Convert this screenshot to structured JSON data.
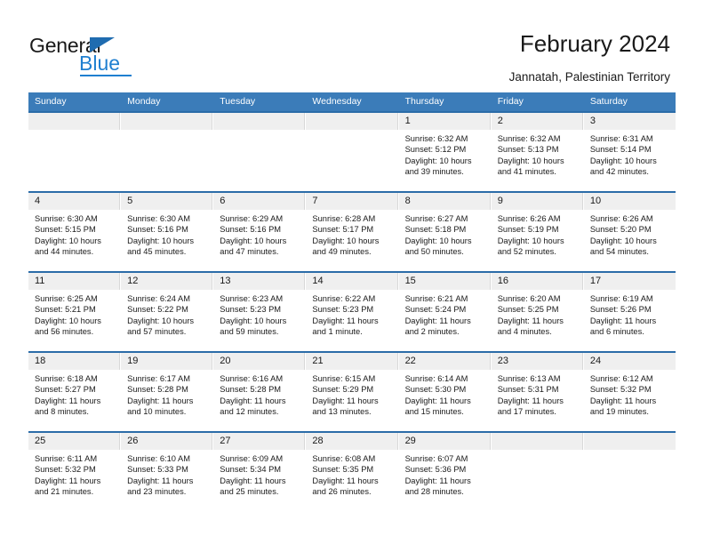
{
  "brand": {
    "name_part1": "General",
    "name_part2": "Blue",
    "triangle_icon": "triangle-icon",
    "colors": {
      "dark": "#1a1a1a",
      "blue": "#1f7fd0",
      "header_blue": "#3b7cb9",
      "separator_blue": "#2b6ca8",
      "daynum_band": "#efefef"
    }
  },
  "header": {
    "title": "February 2024",
    "subtitle": "Jannatah, Palestinian Territory"
  },
  "calendar": {
    "weekdays": [
      "Sunday",
      "Monday",
      "Tuesday",
      "Wednesday",
      "Thursday",
      "Friday",
      "Saturday"
    ],
    "weeks": [
      [
        {
          "day": "",
          "sunrise": "",
          "sunset": "",
          "daylight1": "",
          "daylight2": ""
        },
        {
          "day": "",
          "sunrise": "",
          "sunset": "",
          "daylight1": "",
          "daylight2": ""
        },
        {
          "day": "",
          "sunrise": "",
          "sunset": "",
          "daylight1": "",
          "daylight2": ""
        },
        {
          "day": "",
          "sunrise": "",
          "sunset": "",
          "daylight1": "",
          "daylight2": ""
        },
        {
          "day": "1",
          "sunrise": "Sunrise: 6:32 AM",
          "sunset": "Sunset: 5:12 PM",
          "daylight1": "Daylight: 10 hours",
          "daylight2": "and 39 minutes."
        },
        {
          "day": "2",
          "sunrise": "Sunrise: 6:32 AM",
          "sunset": "Sunset: 5:13 PM",
          "daylight1": "Daylight: 10 hours",
          "daylight2": "and 41 minutes."
        },
        {
          "day": "3",
          "sunrise": "Sunrise: 6:31 AM",
          "sunset": "Sunset: 5:14 PM",
          "daylight1": "Daylight: 10 hours",
          "daylight2": "and 42 minutes."
        }
      ],
      [
        {
          "day": "4",
          "sunrise": "Sunrise: 6:30 AM",
          "sunset": "Sunset: 5:15 PM",
          "daylight1": "Daylight: 10 hours",
          "daylight2": "and 44 minutes."
        },
        {
          "day": "5",
          "sunrise": "Sunrise: 6:30 AM",
          "sunset": "Sunset: 5:16 PM",
          "daylight1": "Daylight: 10 hours",
          "daylight2": "and 45 minutes."
        },
        {
          "day": "6",
          "sunrise": "Sunrise: 6:29 AM",
          "sunset": "Sunset: 5:16 PM",
          "daylight1": "Daylight: 10 hours",
          "daylight2": "and 47 minutes."
        },
        {
          "day": "7",
          "sunrise": "Sunrise: 6:28 AM",
          "sunset": "Sunset: 5:17 PM",
          "daylight1": "Daylight: 10 hours",
          "daylight2": "and 49 minutes."
        },
        {
          "day": "8",
          "sunrise": "Sunrise: 6:27 AM",
          "sunset": "Sunset: 5:18 PM",
          "daylight1": "Daylight: 10 hours",
          "daylight2": "and 50 minutes."
        },
        {
          "day": "9",
          "sunrise": "Sunrise: 6:26 AM",
          "sunset": "Sunset: 5:19 PM",
          "daylight1": "Daylight: 10 hours",
          "daylight2": "and 52 minutes."
        },
        {
          "day": "10",
          "sunrise": "Sunrise: 6:26 AM",
          "sunset": "Sunset: 5:20 PM",
          "daylight1": "Daylight: 10 hours",
          "daylight2": "and 54 minutes."
        }
      ],
      [
        {
          "day": "11",
          "sunrise": "Sunrise: 6:25 AM",
          "sunset": "Sunset: 5:21 PM",
          "daylight1": "Daylight: 10 hours",
          "daylight2": "and 56 minutes."
        },
        {
          "day": "12",
          "sunrise": "Sunrise: 6:24 AM",
          "sunset": "Sunset: 5:22 PM",
          "daylight1": "Daylight: 10 hours",
          "daylight2": "and 57 minutes."
        },
        {
          "day": "13",
          "sunrise": "Sunrise: 6:23 AM",
          "sunset": "Sunset: 5:23 PM",
          "daylight1": "Daylight: 10 hours",
          "daylight2": "and 59 minutes."
        },
        {
          "day": "14",
          "sunrise": "Sunrise: 6:22 AM",
          "sunset": "Sunset: 5:23 PM",
          "daylight1": "Daylight: 11 hours",
          "daylight2": "and 1 minute."
        },
        {
          "day": "15",
          "sunrise": "Sunrise: 6:21 AM",
          "sunset": "Sunset: 5:24 PM",
          "daylight1": "Daylight: 11 hours",
          "daylight2": "and 2 minutes."
        },
        {
          "day": "16",
          "sunrise": "Sunrise: 6:20 AM",
          "sunset": "Sunset: 5:25 PM",
          "daylight1": "Daylight: 11 hours",
          "daylight2": "and 4 minutes."
        },
        {
          "day": "17",
          "sunrise": "Sunrise: 6:19 AM",
          "sunset": "Sunset: 5:26 PM",
          "daylight1": "Daylight: 11 hours",
          "daylight2": "and 6 minutes."
        }
      ],
      [
        {
          "day": "18",
          "sunrise": "Sunrise: 6:18 AM",
          "sunset": "Sunset: 5:27 PM",
          "daylight1": "Daylight: 11 hours",
          "daylight2": "and 8 minutes."
        },
        {
          "day": "19",
          "sunrise": "Sunrise: 6:17 AM",
          "sunset": "Sunset: 5:28 PM",
          "daylight1": "Daylight: 11 hours",
          "daylight2": "and 10 minutes."
        },
        {
          "day": "20",
          "sunrise": "Sunrise: 6:16 AM",
          "sunset": "Sunset: 5:28 PM",
          "daylight1": "Daylight: 11 hours",
          "daylight2": "and 12 minutes."
        },
        {
          "day": "21",
          "sunrise": "Sunrise: 6:15 AM",
          "sunset": "Sunset: 5:29 PM",
          "daylight1": "Daylight: 11 hours",
          "daylight2": "and 13 minutes."
        },
        {
          "day": "22",
          "sunrise": "Sunrise: 6:14 AM",
          "sunset": "Sunset: 5:30 PM",
          "daylight1": "Daylight: 11 hours",
          "daylight2": "and 15 minutes."
        },
        {
          "day": "23",
          "sunrise": "Sunrise: 6:13 AM",
          "sunset": "Sunset: 5:31 PM",
          "daylight1": "Daylight: 11 hours",
          "daylight2": "and 17 minutes."
        },
        {
          "day": "24",
          "sunrise": "Sunrise: 6:12 AM",
          "sunset": "Sunset: 5:32 PM",
          "daylight1": "Daylight: 11 hours",
          "daylight2": "and 19 minutes."
        }
      ],
      [
        {
          "day": "25",
          "sunrise": "Sunrise: 6:11 AM",
          "sunset": "Sunset: 5:32 PM",
          "daylight1": "Daylight: 11 hours",
          "daylight2": "and 21 minutes."
        },
        {
          "day": "26",
          "sunrise": "Sunrise: 6:10 AM",
          "sunset": "Sunset: 5:33 PM",
          "daylight1": "Daylight: 11 hours",
          "daylight2": "and 23 minutes."
        },
        {
          "day": "27",
          "sunrise": "Sunrise: 6:09 AM",
          "sunset": "Sunset: 5:34 PM",
          "daylight1": "Daylight: 11 hours",
          "daylight2": "and 25 minutes."
        },
        {
          "day": "28",
          "sunrise": "Sunrise: 6:08 AM",
          "sunset": "Sunset: 5:35 PM",
          "daylight1": "Daylight: 11 hours",
          "daylight2": "and 26 minutes."
        },
        {
          "day": "29",
          "sunrise": "Sunrise: 6:07 AM",
          "sunset": "Sunset: 5:36 PM",
          "daylight1": "Daylight: 11 hours",
          "daylight2": "and 28 minutes."
        },
        {
          "day": "",
          "sunrise": "",
          "sunset": "",
          "daylight1": "",
          "daylight2": ""
        },
        {
          "day": "",
          "sunrise": "",
          "sunset": "",
          "daylight1": "",
          "daylight2": ""
        }
      ]
    ]
  }
}
